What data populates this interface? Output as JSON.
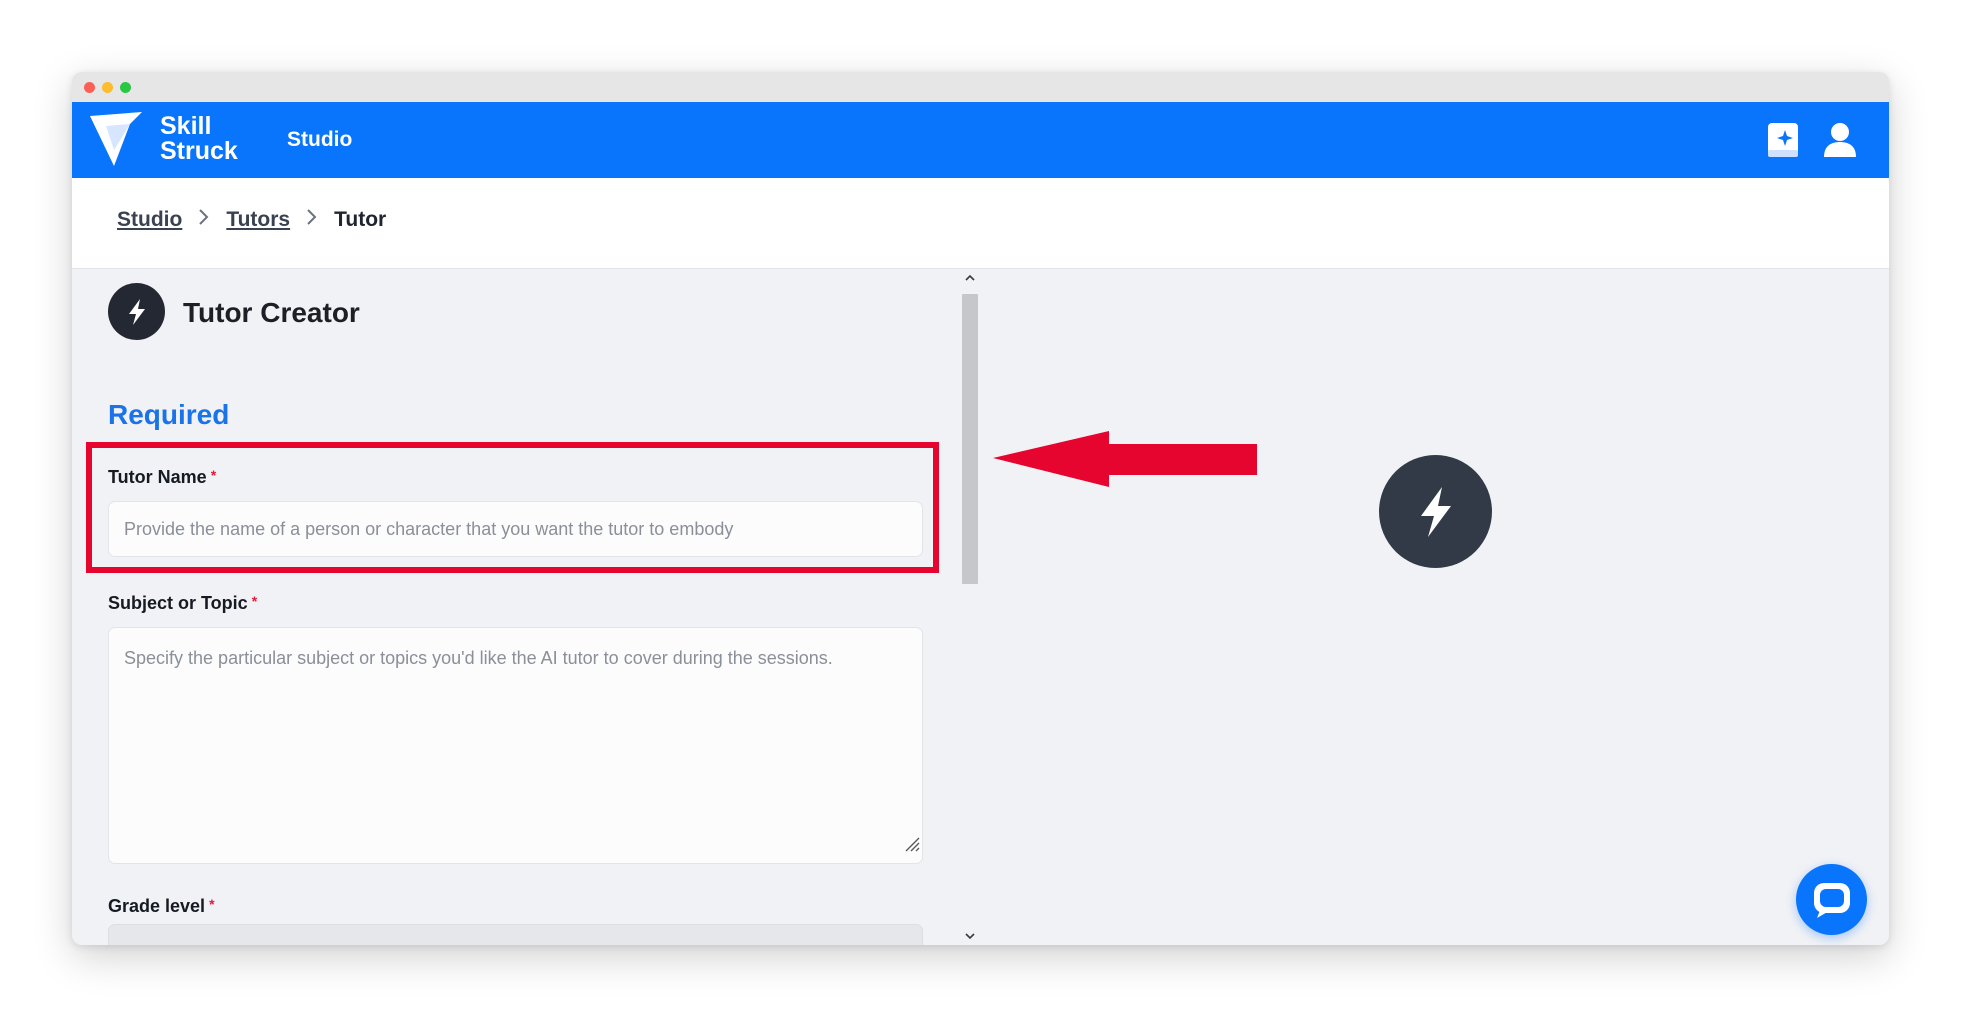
{
  "brand": {
    "logo_line1": "Skill",
    "logo_line2": "Struck",
    "section": "Studio",
    "color": "#0974fc"
  },
  "header_icons": [
    "book-sparkle-icon",
    "user-icon"
  ],
  "breadcrumb": {
    "items": [
      "Studio",
      "Tutors"
    ],
    "current": "Tutor"
  },
  "creator": {
    "title": "Tutor Creator",
    "icon": "lightning-bolt-icon"
  },
  "form": {
    "section_heading": "Required",
    "tutor_name": {
      "label": "Tutor Name",
      "required_mark": "*",
      "value": "",
      "placeholder": "Provide the name of a person or character that you want the tutor to embody"
    },
    "subject": {
      "label": "Subject or Topic",
      "required_mark": "*",
      "value": "",
      "placeholder": "Specify the particular subject or topics you'd like the AI tutor to cover during the sessions."
    },
    "grade_level": {
      "label": "Grade level",
      "required_mark": "*"
    }
  },
  "annotation": {
    "highlight_color": "#e5052f"
  },
  "chat_widget": {
    "icon": "chat-bubble-icon"
  }
}
